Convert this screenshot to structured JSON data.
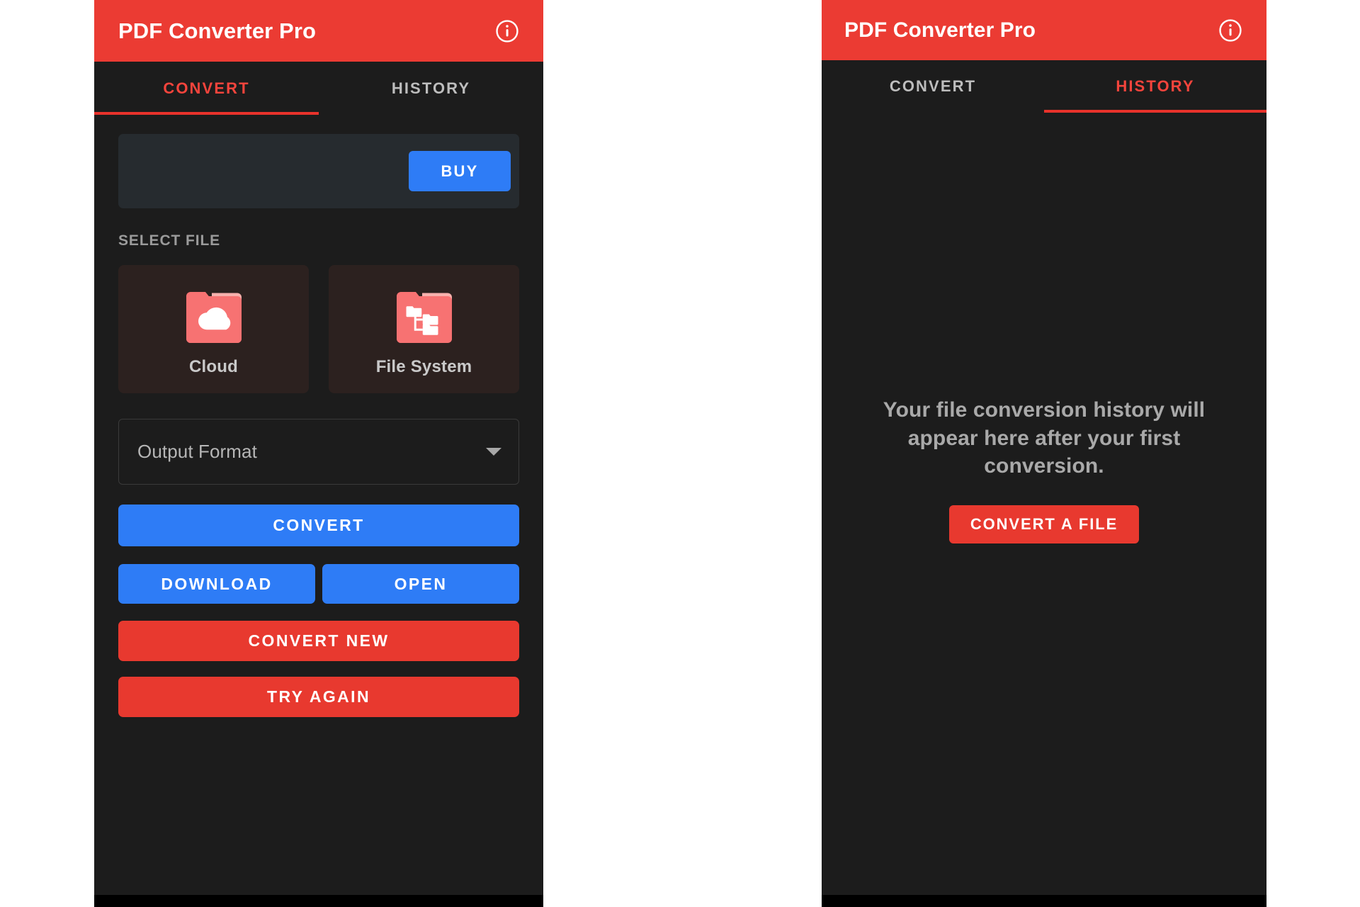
{
  "app": {
    "title": "PDF Converter Pro",
    "accent_red": "#e8392f",
    "accent_blue": "#2e7cf6",
    "background": "#1c1c1c",
    "info_icon": "info-circle-icon"
  },
  "convert_screen": {
    "tabs": [
      {
        "label": "CONVERT",
        "active": true
      },
      {
        "label": "HISTORY",
        "active": false
      }
    ],
    "promo": {
      "buy_label": "BUY"
    },
    "select_file": {
      "section_label": "SELECT FILE",
      "tiles": [
        {
          "label": "Cloud",
          "icon": "folder-cloud-icon"
        },
        {
          "label": "File System",
          "icon": "folder-tree-icon"
        }
      ]
    },
    "output_format": {
      "value": "Output Format",
      "caret": "chevron-down-icon"
    },
    "actions": {
      "convert": "CONVERT",
      "download": "DOWNLOAD",
      "open": "OPEN",
      "convert_new": "CONVERT NEW",
      "try_again": "TRY AGAIN"
    }
  },
  "history_screen": {
    "tabs": [
      {
        "label": "CONVERT",
        "active": false
      },
      {
        "label": "HISTORY",
        "active": true
      }
    ],
    "empty_state": {
      "message": "Your file conversion history will appear here after your first conversion.",
      "cta_label": "CONVERT A FILE"
    }
  }
}
